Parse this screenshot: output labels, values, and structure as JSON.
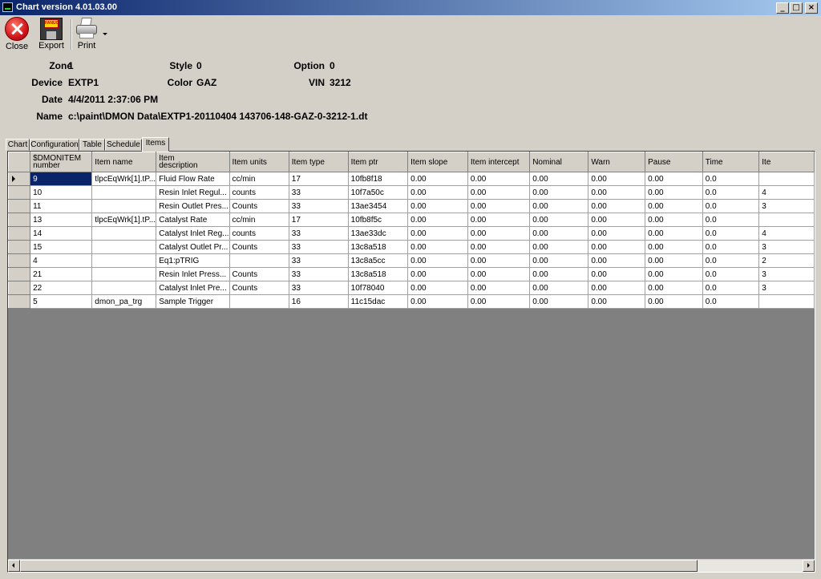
{
  "window": {
    "title": "Chart  version  4.01.03.00",
    "minimize": "_",
    "maximize": "□",
    "close": "×"
  },
  "toolbar": {
    "close_label": "Close",
    "export_label": "Export",
    "print_label": "Print",
    "floppy_text": "FANUC"
  },
  "info": {
    "zone_key": "Zone",
    "zone": "1",
    "style_key": "Style",
    "style": "0",
    "option_key": "Option",
    "option": "0",
    "device_key": "Device",
    "device": "EXTP1",
    "color_key": "Color",
    "color": "GAZ",
    "vin_key": "VIN",
    "vin": "3212",
    "date_key": "Date",
    "date": "4/4/2011 2:37:06 PM",
    "name_key": "Name",
    "name": "c:\\paint\\DMON  Data\\EXTP1-20110404  143706-148-GAZ-0-3212-1.dt"
  },
  "tabs": [
    "Chart",
    "Configuration",
    "Table",
    "Schedule",
    "Items"
  ],
  "active_tab": "Items",
  "grid": {
    "columns": [
      {
        "l1": "$DMONITEM",
        "l2": "number"
      },
      {
        "l1": "Item name",
        "l2": ""
      },
      {
        "l1": "Item",
        "l2": "description"
      },
      {
        "l1": "Item units",
        "l2": ""
      },
      {
        "l1": "Item type",
        "l2": ""
      },
      {
        "l1": "Item ptr",
        "l2": ""
      },
      {
        "l1": "Item slope",
        "l2": ""
      },
      {
        "l1": "Item intercept",
        "l2": ""
      },
      {
        "l1": "Nominal",
        "l2": ""
      },
      {
        "l1": "Warn",
        "l2": ""
      },
      {
        "l1": "Pause",
        "l2": ""
      },
      {
        "l1": "Time",
        "l2": ""
      },
      {
        "l1": "Ite",
        "l2": ""
      }
    ],
    "rows": [
      [
        "9",
        "tlpcEqWrk[1].tP...",
        "Fluid Flow Rate",
        "cc/min",
        "17",
        "10fb8f18",
        "0.00",
        "0.00",
        "0.00",
        "0.00",
        "0.00",
        "0.0",
        ""
      ],
      [
        "10",
        "",
        "Resin Inlet Regul...",
        "counts",
        "33",
        "10f7a50c",
        "0.00",
        "0.00",
        "0.00",
        "0.00",
        "0.00",
        "0.0",
        "4"
      ],
      [
        "11",
        "",
        "Resin Outlet Pres...",
        "Counts",
        "33",
        "13ae3454",
        "0.00",
        "0.00",
        "0.00",
        "0.00",
        "0.00",
        "0.0",
        "3"
      ],
      [
        "13",
        "tlpcEqWrk[1].tP...",
        "Catalyst Rate",
        "cc/min",
        "17",
        "10fb8f5c",
        "0.00",
        "0.00",
        "0.00",
        "0.00",
        "0.00",
        "0.0",
        ""
      ],
      [
        "14",
        "",
        "Catalyst Inlet Reg...",
        "counts",
        "33",
        "13ae33dc",
        "0.00",
        "0.00",
        "0.00",
        "0.00",
        "0.00",
        "0.0",
        "4"
      ],
      [
        "15",
        "",
        "Catalyst Outlet Pr...",
        "Counts",
        "33",
        "13c8a518",
        "0.00",
        "0.00",
        "0.00",
        "0.00",
        "0.00",
        "0.0",
        "3"
      ],
      [
        "4",
        "",
        "Eq1:pTRIG",
        "",
        "33",
        "13c8a5cc",
        "0.00",
        "0.00",
        "0.00",
        "0.00",
        "0.00",
        "0.0",
        "2"
      ],
      [
        "21",
        "",
        "Resin Inlet Press...",
        "Counts",
        "33",
        "13c8a518",
        "0.00",
        "0.00",
        "0.00",
        "0.00",
        "0.00",
        "0.0",
        "3"
      ],
      [
        "22",
        "",
        "Catalyst Inlet Pre...",
        "Counts",
        "33",
        "10f78040",
        "0.00",
        "0.00",
        "0.00",
        "0.00",
        "0.00",
        "0.0",
        "3"
      ],
      [
        "5",
        "dmon_pa_trg",
        "Sample Trigger",
        "",
        "16",
        "11c15dac",
        "0.00",
        "0.00",
        "0.00",
        "0.00",
        "0.00",
        "0.0",
        ""
      ]
    ]
  }
}
